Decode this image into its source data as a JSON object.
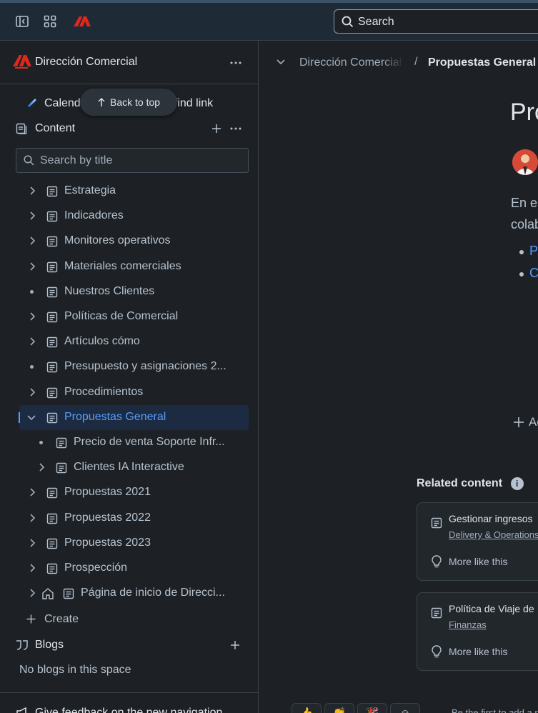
{
  "topbar": {
    "search_label": "Search"
  },
  "sidebar": {
    "space_name": "Dirección Comercial",
    "calendar_label_start": "Calend",
    "calendar_label_end": "t find link",
    "back_to_top": "Back to top",
    "content_label": "Content",
    "search_placeholder": "Search by title",
    "tree": [
      {
        "label": "Estrategia",
        "marker": "chevron"
      },
      {
        "label": "Indicadores",
        "marker": "chevron"
      },
      {
        "label": "Monitores operativos",
        "marker": "chevron"
      },
      {
        "label": "Materiales comerciales",
        "marker": "chevron"
      },
      {
        "label": "Nuestros Clientes",
        "marker": "dot"
      },
      {
        "label": "Políticas de Comercial",
        "marker": "chevron"
      },
      {
        "label": "Artículos cómo",
        "marker": "chevron"
      },
      {
        "label": "Presupuesto y asignaciones 2...",
        "marker": "dot"
      },
      {
        "label": "Procedimientos",
        "marker": "chevron"
      },
      {
        "label": "Propuestas General",
        "marker": "chevron-open",
        "selected": true
      },
      {
        "label": "Precio de venta Soporte Infr...",
        "marker": "dot",
        "child": true
      },
      {
        "label": "Clientes IA Interactive",
        "marker": "chevron",
        "child": true
      },
      {
        "label": "Propuestas 2021",
        "marker": "chevron"
      },
      {
        "label": "Propuestas 2022",
        "marker": "chevron"
      },
      {
        "label": "Propuestas 2023",
        "marker": "chevron"
      },
      {
        "label": "Prospección",
        "marker": "chevron"
      },
      {
        "label": "Página de inicio de Direcci...",
        "marker": "chevron",
        "home": true
      }
    ],
    "create_label": "Create",
    "blogs_label": "Blogs",
    "no_blogs": "No blogs in this space",
    "feedback": "Give feedback on the new navigation"
  },
  "main": {
    "breadcrumb_space": "Dirección Comercial",
    "breadcrumb_sep": "/",
    "breadcrumb_page": "Propuestas General",
    "page_title": "Pro",
    "body_line1": "En es",
    "body_line2": "colab",
    "bullet1": "P",
    "bullet2": "C",
    "add_label": "Ad",
    "related_title": "Related content",
    "related_cards": [
      {
        "title": "Gestionar ingresos",
        "space": "Delivery & Operations",
        "more": "More like this"
      },
      {
        "title": "Política de Viaje de",
        "space": "Finanzas",
        "more": "More like this"
      }
    ],
    "reaction_text": "Be the first to add a reaction"
  },
  "colors": {
    "accent": "#579dff",
    "brand": "#e2261c",
    "background": "#1d2125"
  }
}
